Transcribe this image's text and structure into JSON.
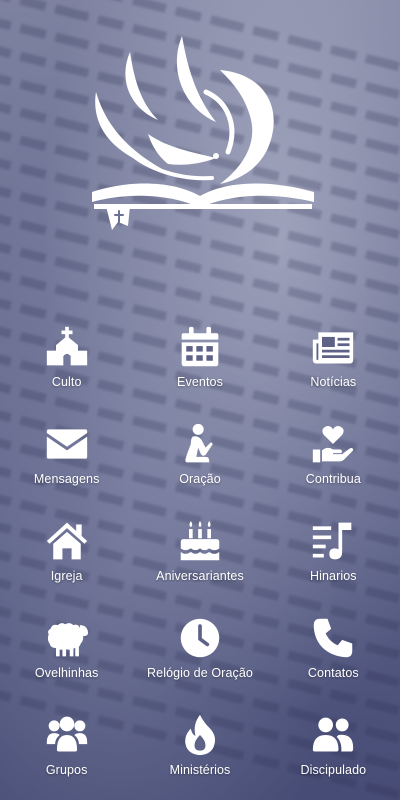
{
  "menu": {
    "items": [
      {
        "label": "Culto",
        "icon": "church-icon"
      },
      {
        "label": "Eventos",
        "icon": "calendar-icon"
      },
      {
        "label": "Notícias",
        "icon": "newspaper-icon"
      },
      {
        "label": "Mensagens",
        "icon": "envelope-icon"
      },
      {
        "label": "Oração",
        "icon": "praying-icon"
      },
      {
        "label": "Contribua",
        "icon": "hand-heart-icon"
      },
      {
        "label": "Igreja",
        "icon": "home-icon"
      },
      {
        "label": "Aniversariantes",
        "icon": "birthday-cake-icon"
      },
      {
        "label": "Hinarios",
        "icon": "music-list-icon"
      },
      {
        "label": "Ovelhinhas",
        "icon": "sheep-icon"
      },
      {
        "label": "Relógio de Oração",
        "icon": "clock-icon"
      },
      {
        "label": "Contatos",
        "icon": "phone-icon"
      },
      {
        "label": "Grupos",
        "icon": "users-group-icon"
      },
      {
        "label": "Ministérios",
        "icon": "flame-icon"
      },
      {
        "label": "Discipulado",
        "icon": "user-friends-icon"
      }
    ]
  },
  "theme": {
    "icon_color": "#ffffff",
    "background": "#5d6286"
  }
}
